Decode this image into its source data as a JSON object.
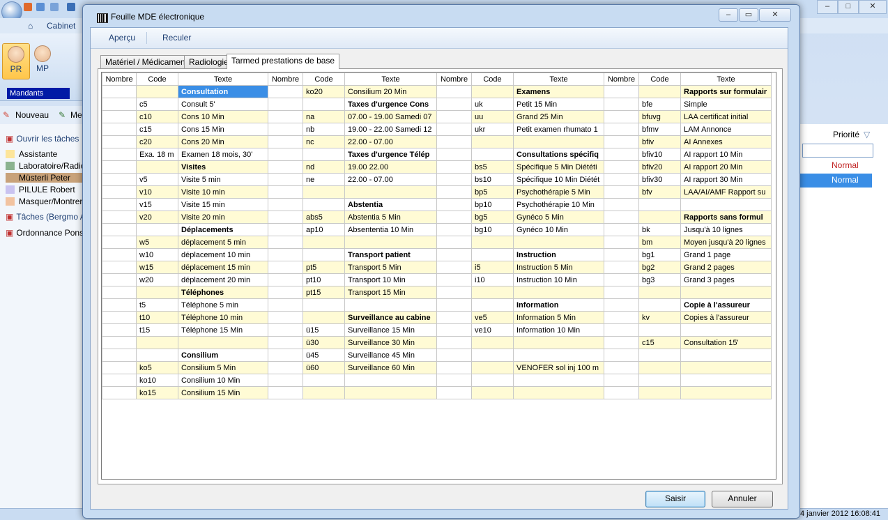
{
  "background_app": {
    "tab_cabinet": "Cabinet",
    "avatar_pr": "PR",
    "avatar_mp": "MP",
    "mandants": "Mandants",
    "nouveau": "Nouveau",
    "me": "Me",
    "ouvrir_taches": "Ouvrir les tâches",
    "left_items": [
      {
        "label": "Assistante",
        "color": "#fde59a"
      },
      {
        "label": "Laboratoire/Radiologie",
        "color": "#8bb38f"
      },
      {
        "label": "Müsterli Peter",
        "color": "#c8a27a"
      },
      {
        "label": "PILULE Robert",
        "color": "#c9c3f0"
      },
      {
        "label": "Masquer/Montrer (",
        "color": "#f2c3a0"
      }
    ],
    "taches": "Tâches (Bergmo A",
    "ordonnance": "Ordonnance Pons",
    "priorite": "Priorité",
    "priority_rows": [
      "Normal",
      "Normal"
    ],
    "status_right": "4 janvier 2012 16:08:41"
  },
  "dialog": {
    "title": "Feuille MDE électronique",
    "menu": {
      "apercu": "Aperçu",
      "reculer": "Reculer"
    },
    "tabs": [
      "Matériel / Médicament",
      "Radiologie",
      "Tarmed prestations de base"
    ],
    "active_tab": 2,
    "headers": [
      "Nombre",
      "Code",
      "Texte",
      "Nombre",
      "Code",
      "Texte",
      "Nombre",
      "Code",
      "Texte",
      "Nombre",
      "Code",
      "Texte"
    ],
    "rows": [
      [
        [
          "",
          "",
          "Consultation"
        ],
        [
          "",
          "ko20",
          "Consilium 20 Min"
        ],
        [
          "",
          "",
          "Examens"
        ],
        [
          "",
          "",
          "Rapports sur formulair"
        ]
      ],
      [
        [
          "",
          "c5",
          "Consult 5'"
        ],
        [
          "",
          "",
          "Taxes d'urgence Cons"
        ],
        [
          "",
          "uk",
          "Petit 15 Min"
        ],
        [
          "",
          "bfe",
          "Simple"
        ]
      ],
      [
        [
          "",
          "c10",
          "Cons 10 Min"
        ],
        [
          "",
          "na",
          "07.00 - 19.00 Samedi 07"
        ],
        [
          "",
          "uu",
          "Grand 25 Min"
        ],
        [
          "",
          "bfuvg",
          "LAA certificat initial"
        ]
      ],
      [
        [
          "",
          "c15",
          "Cons 15 Min"
        ],
        [
          "",
          "nb",
          "19.00 - 22.00 Samedi 12"
        ],
        [
          "",
          "ukr",
          "Petit examen rhumato 1"
        ],
        [
          "",
          "bfmv",
          "LAM Annonce"
        ]
      ],
      [
        [
          "",
          "c20",
          "Cons 20 Min"
        ],
        [
          "",
          "nc",
          "22.00 - 07.00"
        ],
        [
          "",
          "",
          ""
        ],
        [
          "",
          "bfiv",
          "AI Annexes"
        ]
      ],
      [
        [
          "",
          "Exa. 18 m",
          "Examen 18 mois, 30'"
        ],
        [
          "",
          "",
          "Taxes d'urgence Télép"
        ],
        [
          "",
          "",
          "Consultations spécifiq"
        ],
        [
          "",
          "bfiv10",
          "AI rapport 10 Min"
        ]
      ],
      [
        [
          "",
          "",
          "Visites"
        ],
        [
          "",
          "nd",
          "19.00 22.00"
        ],
        [
          "",
          "bs5",
          "Spécifique 5 Min Diététi"
        ],
        [
          "",
          "bfiv20",
          "AI rapport 20 Min"
        ]
      ],
      [
        [
          "",
          "v5",
          "Visite 5 min"
        ],
        [
          "",
          "ne",
          "22.00 - 07.00"
        ],
        [
          "",
          "bs10",
          "Spécifique 10 Min Diétét"
        ],
        [
          "",
          "bfiv30",
          "AI rapport 30 Min"
        ]
      ],
      [
        [
          "",
          "v10",
          "Visite 10 min"
        ],
        [
          "",
          "",
          ""
        ],
        [
          "",
          "bp5",
          "Psychothérapie 5 Min"
        ],
        [
          "",
          "bfv",
          "LAA/AI/AMF Rapport su"
        ]
      ],
      [
        [
          "",
          "v15",
          "Visite 15 min"
        ],
        [
          "",
          "",
          "Abstentia"
        ],
        [
          "",
          "bp10",
          "Psychothérapie 10 Min"
        ],
        [
          "",
          "",
          ""
        ]
      ],
      [
        [
          "",
          "v20",
          "Visite 20 min"
        ],
        [
          "",
          "abs5",
          "Abstentia 5 Min"
        ],
        [
          "",
          "bg5",
          "Gynéco 5 Min"
        ],
        [
          "",
          "",
          "Rapports sans formul"
        ]
      ],
      [
        [
          "",
          "",
          "Déplacements"
        ],
        [
          "",
          "ap10",
          "Absententia 10 Min"
        ],
        [
          "",
          "bg10",
          "Gynéco 10 Min"
        ],
        [
          "",
          "bk",
          "Jusqu'à 10 lignes"
        ]
      ],
      [
        [
          "",
          "w5",
          "déplacement 5 min"
        ],
        [
          "",
          "",
          ""
        ],
        [
          "",
          "",
          ""
        ],
        [
          "",
          "bm",
          "Moyen jusqu'à 20 lignes"
        ]
      ],
      [
        [
          "",
          "w10",
          "déplacement 10 min"
        ],
        [
          "",
          "",
          "Transport patient"
        ],
        [
          "",
          "",
          "Instruction"
        ],
        [
          "",
          "bg1",
          "Grand 1 page"
        ]
      ],
      [
        [
          "",
          "w15",
          "déplacement 15 min"
        ],
        [
          "",
          "pt5",
          "Transport 5 Min"
        ],
        [
          "",
          "i5",
          "Instruction 5 Min"
        ],
        [
          "",
          "bg2",
          "Grand 2 pages"
        ]
      ],
      [
        [
          "",
          "w20",
          "déplacement 20 min"
        ],
        [
          "",
          "pt10",
          "Transport 10 Min"
        ],
        [
          "",
          "i10",
          "Instruction 10 Min"
        ],
        [
          "",
          "bg3",
          "Grand 3 pages"
        ]
      ],
      [
        [
          "",
          "",
          "Téléphones"
        ],
        [
          "",
          "pt15",
          "Transport 15 Min"
        ],
        [
          "",
          "",
          ""
        ],
        [
          "",
          "",
          ""
        ]
      ],
      [
        [
          "",
          "t5",
          "Téléphone 5 min"
        ],
        [
          "",
          "",
          ""
        ],
        [
          "",
          "",
          "Information"
        ],
        [
          "",
          "",
          "Copie à l'assureur"
        ]
      ],
      [
        [
          "",
          "t10",
          "Téléphone 10 min"
        ],
        [
          "",
          "",
          "Surveillance au cabine"
        ],
        [
          "",
          "ve5",
          "Information 5 Min"
        ],
        [
          "",
          "kv",
          "Copies à l'assureur"
        ]
      ],
      [
        [
          "",
          "t15",
          "Téléphone 15 Min"
        ],
        [
          "",
          "ü15",
          "Surveillance 15 Min"
        ],
        [
          "",
          "ve10",
          "Information 10 Min"
        ],
        [
          "",
          "",
          ""
        ]
      ],
      [
        [
          "",
          "",
          ""
        ],
        [
          "",
          "ü30",
          "Surveillance 30 Min"
        ],
        [
          "",
          "",
          ""
        ],
        [
          "",
          "c15",
          "Consultation 15'"
        ]
      ],
      [
        [
          "",
          "",
          "Consilium"
        ],
        [
          "",
          "ü45",
          "Surveillance 45 Min"
        ],
        [
          "",
          "",
          ""
        ],
        [
          "",
          "",
          ""
        ]
      ],
      [
        [
          "",
          "ko5",
          "Consilium 5 Min"
        ],
        [
          "",
          "ü60",
          "Surveillance 60 Min"
        ],
        [
          "",
          "",
          "VENOFER sol inj 100 m"
        ],
        [
          "",
          "",
          ""
        ]
      ],
      [
        [
          "",
          "ko10",
          "Consilium 10 Min"
        ],
        [
          "",
          "",
          ""
        ],
        [
          "",
          "",
          ""
        ],
        [
          "",
          "",
          ""
        ]
      ],
      [
        [
          "",
          "ko15",
          "Consilium 15 Min"
        ],
        [
          "",
          "",
          ""
        ],
        [
          "",
          "",
          ""
        ],
        [
          "",
          "",
          ""
        ]
      ]
    ],
    "bold_cells": [
      [
        0,
        0
      ],
      [
        0,
        2
      ],
      [
        0,
        3
      ],
      [
        1,
        1
      ],
      [
        5,
        1
      ],
      [
        5,
        2
      ],
      [
        6,
        0
      ],
      [
        9,
        1
      ],
      [
        10,
        3
      ],
      [
        11,
        0
      ],
      [
        13,
        1
      ],
      [
        13,
        2
      ],
      [
        16,
        0
      ],
      [
        17,
        2
      ],
      [
        17,
        3
      ],
      [
        18,
        1
      ],
      [
        21,
        0
      ]
    ],
    "selected_cell": [
      0,
      0
    ],
    "buttons": {
      "saisir": "Saisir",
      "annuler": "Annuler"
    }
  }
}
